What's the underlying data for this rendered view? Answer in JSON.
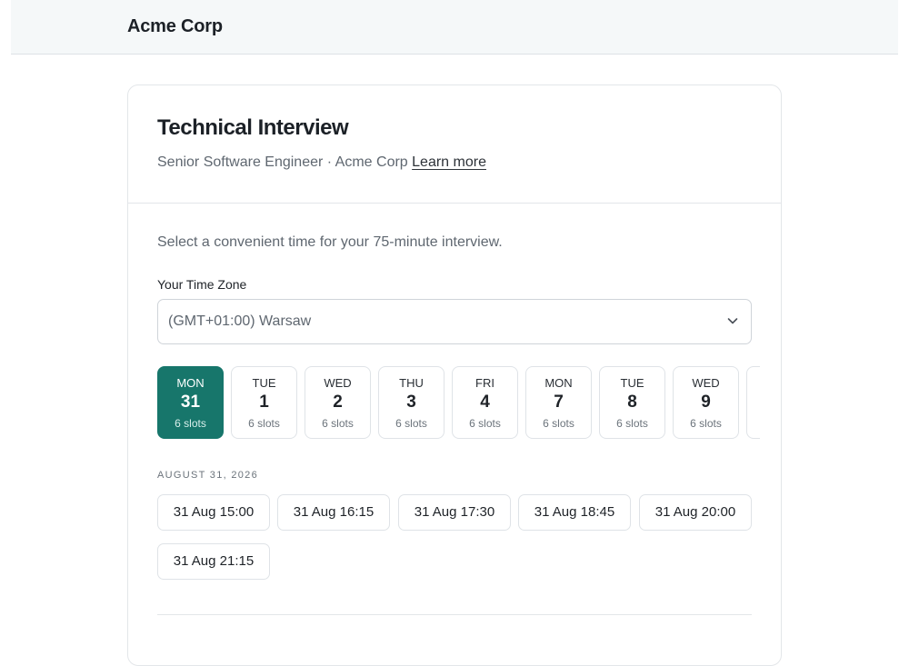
{
  "header": {
    "brand": "Acme Corp"
  },
  "card": {
    "title": "Technical Interview",
    "subtitle": "Senior Software Engineer · Acme Corp",
    "learn_more": "Learn more",
    "intro": "Select a convenient time for your 75-minute interview.",
    "timezone": {
      "label": "Your Time Zone",
      "value": "(GMT+01:00) Warsaw"
    },
    "days": [
      {
        "dow": "MON",
        "num": "31",
        "slots": "6 slots",
        "selected": true
      },
      {
        "dow": "TUE",
        "num": "1",
        "slots": "6 slots",
        "selected": false
      },
      {
        "dow": "WED",
        "num": "2",
        "slots": "6 slots",
        "selected": false
      },
      {
        "dow": "THU",
        "num": "3",
        "slots": "6 slots",
        "selected": false
      },
      {
        "dow": "FRI",
        "num": "4",
        "slots": "6 slots",
        "selected": false
      },
      {
        "dow": "MON",
        "num": "7",
        "slots": "6 slots",
        "selected": false
      },
      {
        "dow": "TUE",
        "num": "8",
        "slots": "6 slots",
        "selected": false
      },
      {
        "dow": "WED",
        "num": "9",
        "slots": "6 slots",
        "selected": false
      },
      {
        "dow": "",
        "num": "",
        "slots": "",
        "selected": false
      }
    ],
    "date_heading": "AUGUST 31, 2026",
    "time_slots": [
      "31 Aug 15:00",
      "31 Aug 16:15",
      "31 Aug 17:30",
      "31 Aug 18:45",
      "31 Aug 20:00",
      "31 Aug 21:15"
    ]
  },
  "colors": {
    "accent": "#17766b",
    "header_bg": "#f5f8f9",
    "border": "#dfe3e7"
  },
  "icons": {
    "timezone_dropdown": "chevron-down-icon"
  }
}
